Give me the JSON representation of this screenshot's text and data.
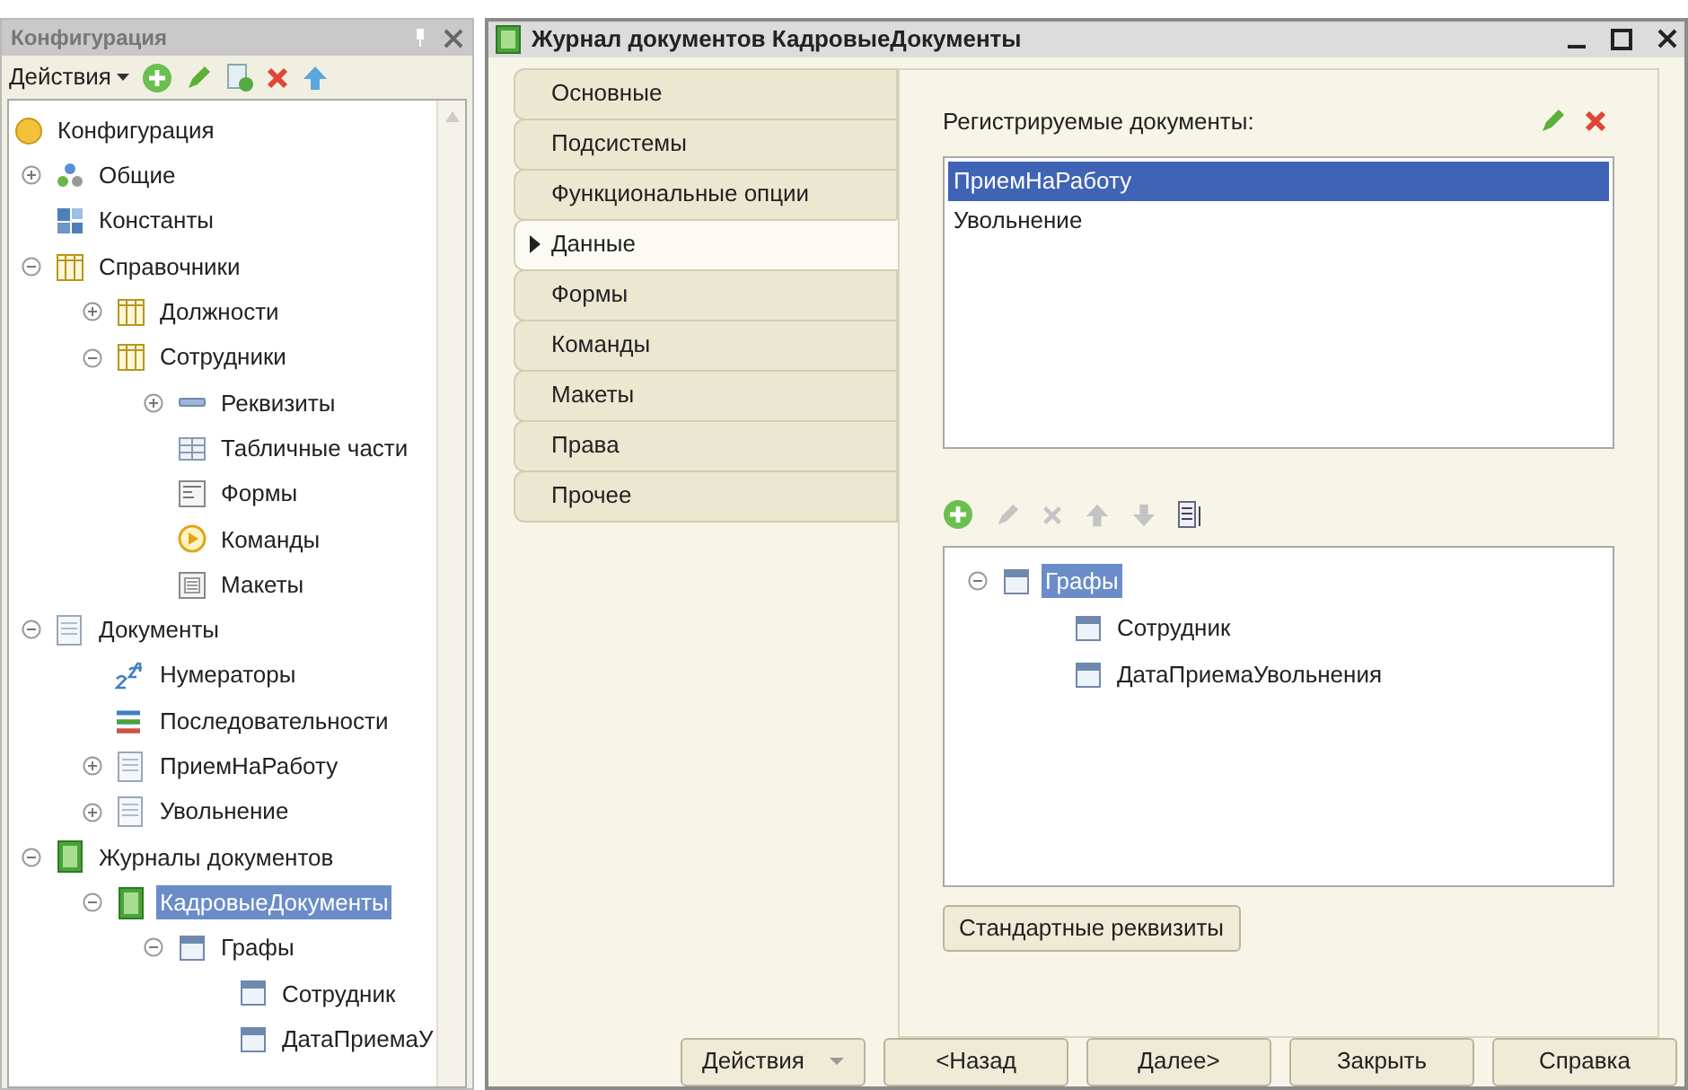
{
  "config_panel": {
    "title": "Конфигурация",
    "actions_label": "Действия",
    "tree": [
      {
        "label": "Конфигурация",
        "kind": "config",
        "selected": false,
        "children": [
          {
            "label": "Общие",
            "kind": "common",
            "expanded": false,
            "selected": false
          },
          {
            "label": "Константы",
            "kind": "constants",
            "selected": false
          },
          {
            "label": "Справочники",
            "kind": "catalog",
            "expanded": true,
            "selected": false,
            "children": [
              {
                "label": "Должности",
                "kind": "catalog",
                "expanded": false,
                "selected": false
              },
              {
                "label": "Сотрудники",
                "kind": "catalog",
                "expanded": true,
                "selected": false,
                "children": [
                  {
                    "label": "Реквизиты",
                    "kind": "attributes",
                    "expanded": false,
                    "selected": false
                  },
                  {
                    "label": "Табличные части",
                    "kind": "tabular",
                    "selected": false
                  },
                  {
                    "label": "Формы",
                    "kind": "forms",
                    "selected": false
                  },
                  {
                    "label": "Команды",
                    "kind": "commands",
                    "selected": false
                  },
                  {
                    "label": "Макеты",
                    "kind": "templates",
                    "selected": false
                  }
                ]
              }
            ]
          },
          {
            "label": "Документы",
            "kind": "document",
            "expanded": true,
            "selected": false,
            "children": [
              {
                "label": "Нумераторы",
                "kind": "numerators",
                "selected": false
              },
              {
                "label": "Последовательности",
                "kind": "sequences",
                "selected": false
              },
              {
                "label": "ПриемНаРаботу",
                "kind": "document",
                "expanded": false,
                "selected": false
              },
              {
                "label": "Увольнение",
                "kind": "document",
                "expanded": false,
                "selected": false
              }
            ]
          },
          {
            "label": "Журналы документов",
            "kind": "journal",
            "expanded": true,
            "selected": false,
            "children": [
              {
                "label": "КадровыеДокументы",
                "kind": "journal",
                "expanded": true,
                "selected": true,
                "children": [
                  {
                    "label": "Графы",
                    "kind": "columns",
                    "expanded": true,
                    "selected": false,
                    "children": [
                      {
                        "label": "Сотрудник",
                        "kind": "column",
                        "selected": false
                      },
                      {
                        "label": "ДатаПриемаУ",
                        "kind": "column",
                        "selected": false
                      }
                    ]
                  }
                ]
              }
            ]
          }
        ]
      }
    ]
  },
  "window": {
    "title": "Журнал документов КадровыеДокументы",
    "tabs": [
      {
        "label": "Основные",
        "selected": false
      },
      {
        "label": "Подсистемы",
        "selected": false
      },
      {
        "label": "Функциональные опции",
        "selected": false
      },
      {
        "label": "Данные",
        "selected": true
      },
      {
        "label": "Формы",
        "selected": false
      },
      {
        "label": "Команды",
        "selected": false
      },
      {
        "label": "Макеты",
        "selected": false
      },
      {
        "label": "Права",
        "selected": false
      },
      {
        "label": "Прочее",
        "selected": false
      }
    ],
    "registered_label": "Регистрируемые документы:",
    "registered": [
      {
        "label": "ПриемНаРаботу",
        "selected": true
      },
      {
        "label": "Увольнение",
        "selected": false
      }
    ],
    "columns_tree": [
      {
        "label": "Графы",
        "kind": "columns",
        "expanded": true,
        "selected": true,
        "children": [
          {
            "label": "Сотрудник",
            "kind": "column",
            "selected": false
          },
          {
            "label": "ДатаПриемаУвольнения",
            "kind": "column",
            "selected": false
          }
        ]
      }
    ],
    "standard_button": "Стандартные реквизиты",
    "buttons": [
      {
        "label": "Действия",
        "kind": "dropdown"
      },
      {
        "label": "<Назад",
        "kind": "plain"
      },
      {
        "label": "Далее>",
        "kind": "plain"
      },
      {
        "label": "Закрыть",
        "kind": "plain"
      },
      {
        "label": "Справка",
        "kind": "plain"
      }
    ]
  }
}
